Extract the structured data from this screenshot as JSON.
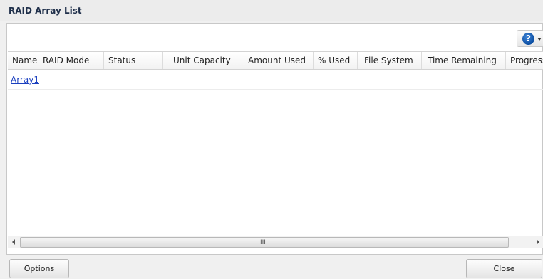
{
  "window": {
    "title": "RAID Array List"
  },
  "toolbar": {
    "help_icon": "help-icon",
    "help_glyph": "?"
  },
  "table": {
    "columns": [
      "Name",
      "RAID Mode",
      "Status",
      "Unit Capacity",
      "Amount Used",
      "% Used",
      "File System",
      "Time Remaining",
      "Progress"
    ],
    "rows": [
      {
        "name": "Array1",
        "raid_mode": "",
        "status": "",
        "unit_capacity": "",
        "amount_used": "",
        "percent_used": "",
        "file_system": "",
        "time_remaining": "",
        "progress": ""
      }
    ]
  },
  "scrollbar": {
    "grip": "III"
  },
  "buttons": {
    "options": "Options",
    "close": "Close"
  }
}
